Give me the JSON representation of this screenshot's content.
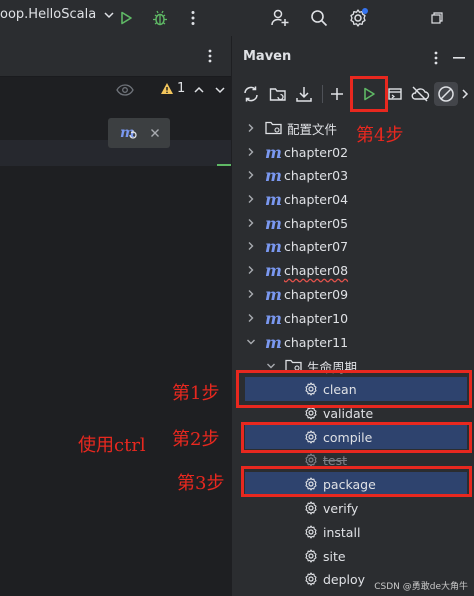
{
  "titlebar": {
    "run_config": "oop.HelloScala"
  },
  "editor": {
    "warning_count": "1"
  },
  "maven": {
    "title": "Maven",
    "tree": {
      "config_files": "配置文件",
      "modules": [
        "chapter02",
        "chapter03",
        "chapter04",
        "chapter05",
        "chapter07",
        "chapter08",
        "chapter09",
        "chapter10",
        "chapter11"
      ],
      "lifecycle_folder": "生命周期",
      "phases": [
        "clean",
        "validate",
        "compile",
        "test",
        "package",
        "verify",
        "install",
        "site",
        "deploy"
      ]
    }
  },
  "annotations": {
    "step1": "第1步",
    "step2": "第2步",
    "step3": "第3步",
    "step4": "第4步",
    "ctrl_note": "使用ctrl"
  },
  "watermark": "CSDN @勇敢de大角牛",
  "colors": {
    "accent_red": "#e8281f",
    "selection": "#2e436e",
    "run_green": "#5fb865",
    "maven_blue": "#7a98f0"
  }
}
